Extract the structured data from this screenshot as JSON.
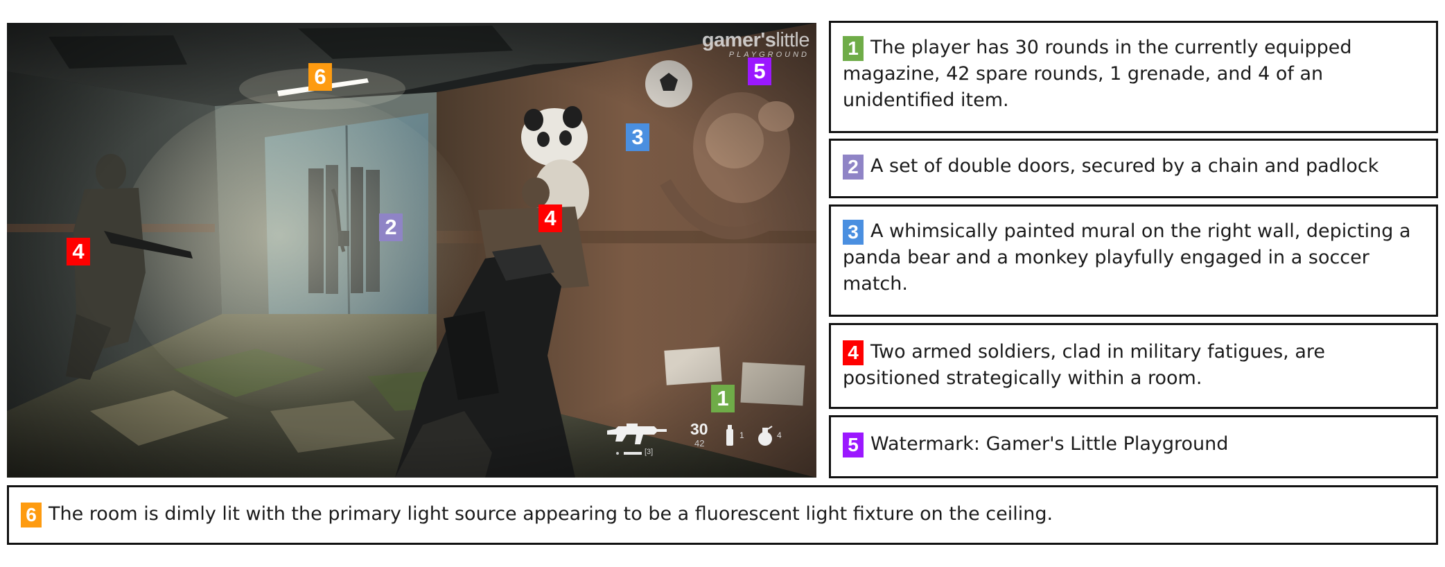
{
  "watermark": {
    "brand_bold": "gamer's",
    "brand_thin": "little",
    "tagline": "PLAYGROUND"
  },
  "hud": {
    "weapon_icon": "assault-rifle-icon",
    "fire_mode": "[3]",
    "ammo_in_magazine": "30",
    "ammo_reserve": "42",
    "item_1_icon": "canister-icon",
    "item_1_count": "1",
    "item_2_icon": "grenade-icon",
    "item_2_count": "4"
  },
  "markers": {
    "m1": "1",
    "m2": "2",
    "m3": "3",
    "m4a": "4",
    "m4b": "4",
    "m5": "5",
    "m6": "6"
  },
  "annotations": [
    {
      "number": "1",
      "color": "#6fac48",
      "text": "The player has 30 rounds in the currently equipped magazine, 42 spare rounds, 1 grenade, and 4 of an unidentified item."
    },
    {
      "number": "2",
      "color": "#8f84c6",
      "text": "A set of double doors, secured by a chain and padlock"
    },
    {
      "number": "3",
      "color": "#4a8fe0",
      "text": "A whimsically painted mural on the right wall, depicting a panda bear and a monkey playfully engaged in a soccer match."
    },
    {
      "number": "4",
      "color": "#ff0000",
      "text": "Two armed soldiers, clad in military fatigues, are positioned strategically within a room."
    },
    {
      "number": "5",
      "color": "#9b18ff",
      "text": "Watermark: Gamer's Little Playground"
    },
    {
      "number": "6",
      "color": "#fe9b10",
      "text": "The room is dimly lit with the primary light source appearing to be a fluorescent light fixture on the ceiling."
    }
  ]
}
